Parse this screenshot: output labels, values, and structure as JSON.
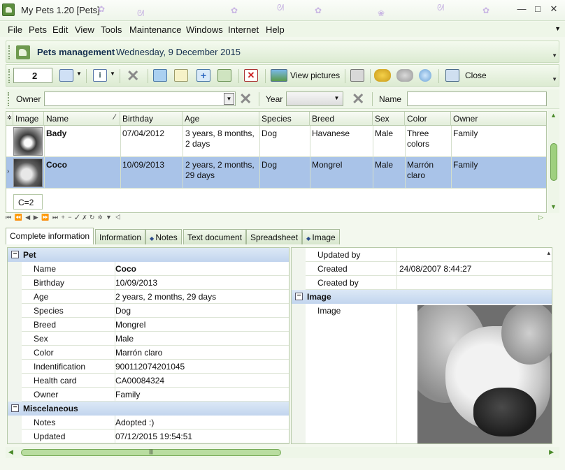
{
  "window": {
    "title": "My Pets 1.20  [Pets]",
    "minimize": "—",
    "maximize": "□",
    "close": "✕"
  },
  "menu": [
    "File",
    "Pets",
    "Edit",
    "View",
    "Tools",
    "Maintenance",
    "Windows",
    "Internet",
    "Help"
  ],
  "header": {
    "title": "Pets management",
    "date": "Wednesday, 9 December 2015"
  },
  "toolbar": {
    "record_value": "2",
    "view_pictures": "View pictures",
    "close": "Close"
  },
  "filters": {
    "owner_label": "Owner",
    "year_label": "Year",
    "name_label": "Name",
    "owner_value": "",
    "year_value": "",
    "name_value": ""
  },
  "grid": {
    "columns": [
      "Image",
      "Name",
      "Birthday",
      "Age",
      "Species",
      "Breed",
      "Sex",
      "Color",
      "Owner"
    ],
    "rows": [
      {
        "name": "Bady",
        "birthday": "07/04/2012",
        "age1": "3 years, 8 months,",
        "age2": "2 days",
        "species": "Dog",
        "breed": "Havanese",
        "sex": "Male",
        "color1": "Three",
        "color2": "colors",
        "owner": "Family"
      },
      {
        "name": "Coco",
        "birthday": "10/09/2013",
        "age1": "2 years, 2 months,",
        "age2": "29 days",
        "species": "Dog",
        "breed": "Mongrel",
        "sex": "Male",
        "color1": "Marrón",
        "color2": "claro",
        "owner": "Family"
      }
    ],
    "count": "C=2"
  },
  "tabs": [
    "Complete information",
    "Information",
    "Notes",
    "Text document",
    "Spreadsheet",
    "Image"
  ],
  "details": {
    "pet_section": "Pet",
    "pet": [
      {
        "label": "Name",
        "value": "Coco"
      },
      {
        "label": "Birthday",
        "value": "10/09/2013"
      },
      {
        "label": "Age",
        "value": "2 years, 2 months, 29 days"
      },
      {
        "label": "Species",
        "value": "Dog"
      },
      {
        "label": "Breed",
        "value": "Mongrel"
      },
      {
        "label": "Sex",
        "value": "Male"
      },
      {
        "label": "Color",
        "value": "Marrón claro"
      },
      {
        "label": "Indentification",
        "value": "900112074201045"
      },
      {
        "label": "Health card",
        "value": "CA00084324"
      },
      {
        "label": "Owner",
        "value": "Family"
      }
    ],
    "misc_section": "Miscelaneous",
    "misc": [
      {
        "label": "Notes",
        "value": "Adopted :)"
      },
      {
        "label": "Updated",
        "value": "07/12/2015 19:54:51"
      }
    ],
    "right": [
      {
        "label": "Updated by",
        "value": ""
      },
      {
        "label": "Created",
        "value": "24/08/2007 8:44:27"
      },
      {
        "label": "Created by",
        "value": ""
      }
    ],
    "image_section": "Image",
    "image_label": "Image"
  }
}
